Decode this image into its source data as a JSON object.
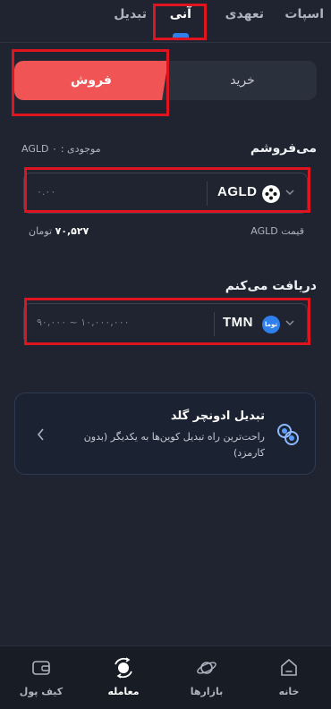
{
  "tabs": {
    "spot": "اسپات",
    "margin": "تعهدی",
    "instant": "آنی",
    "convert": "تبدیل"
  },
  "trade_switch": {
    "buy": "خرید",
    "sell": "فروش"
  },
  "sell_section": {
    "title": "می‌فروشم",
    "balance_label": "موجودی :",
    "balance_value": "AGLD ۰",
    "amount_value": "۰.۰۰",
    "ticker": "AGLD"
  },
  "price": {
    "label": "قیمت AGLD",
    "value": "۷۰,۵۲۷",
    "unit": "تومان"
  },
  "receive_section": {
    "title": "دریافت می‌کنم",
    "amount_placeholder": "۹۰,۰۰۰ ~ ۱۰,۰۰۰,۰۰۰",
    "ticker": "TMN",
    "icon_text": "توما"
  },
  "banner": {
    "title": "تبدیل ادونچر گلد",
    "description": "راحت‌ترین راه تبدیل کوین‌ها به یکدیگر (بدون کارمزد)"
  },
  "bottom_nav": {
    "home": "خانه",
    "markets": "بازارها",
    "trade": "معامله",
    "wallet": "کیف پول"
  },
  "colors": {
    "accent": "#2f80ed",
    "sell": "#f05454",
    "highlight": "#e0141e"
  }
}
